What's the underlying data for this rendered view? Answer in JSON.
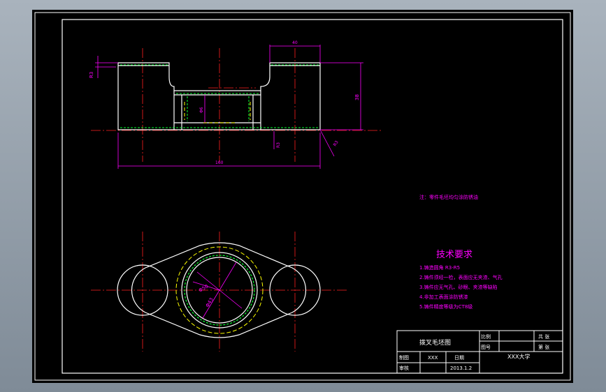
{
  "drawing": {
    "note": "注：零件毛坯均匀涂防锈油",
    "tech_title": "技术要求",
    "tech_items": [
      "1.铸造圆角 R3-R5",
      "2.铸件须经一检，表面应无夹渣、气孔",
      "3.铸件应无气孔、砂眼、夹渣等缺陷",
      "4.非加工表面涂防锈漆",
      "5.铸件精度等级为CT8级"
    ],
    "dims": {
      "top_left": "R3",
      "slot_width": "40",
      "right_height": "38",
      "inner_dia": "Φ6",
      "bottom_left": "R3",
      "bottom_right": "R3",
      "overall": "160",
      "dia_large": "Φ50",
      "dia_small": "Φ43"
    },
    "title_block": {
      "part_name": "拨叉毛坯图",
      "scale_label": "比例",
      "count_label": "共 张",
      "drawing_no_label": "图号",
      "sheet_label": "第 张",
      "drawn_label": "制图",
      "drawn_name": "XXX",
      "date_label": "日期",
      "date_value": "2013.1.2",
      "review_label": "审核",
      "school": "XXX大学"
    }
  }
}
